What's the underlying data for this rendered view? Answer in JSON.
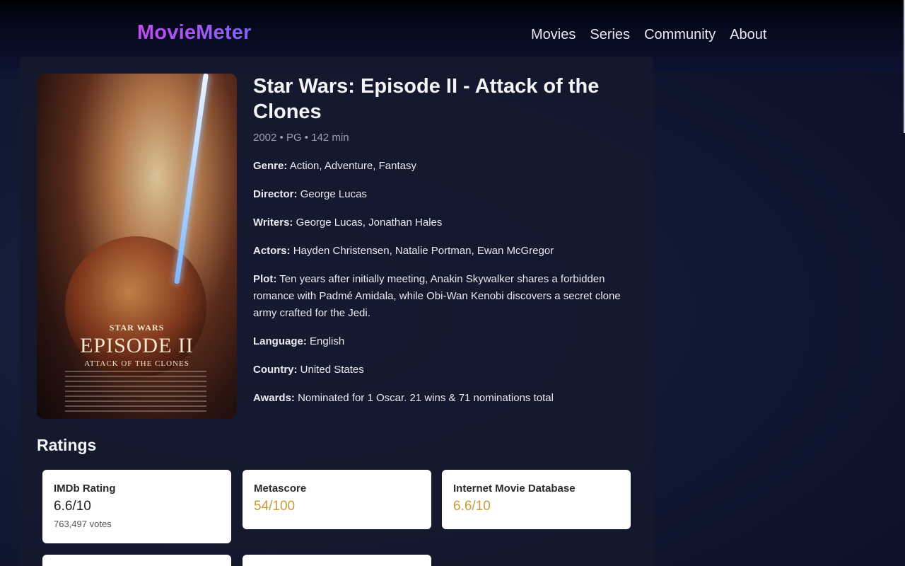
{
  "header": {
    "logo": "MovieMeter",
    "nav": [
      "Movies",
      "Series",
      "Community",
      "About"
    ]
  },
  "movie": {
    "title": "Star Wars: Episode II - Attack of the Clones",
    "meta": "2002 • PG • 142 min",
    "poster": {
      "line1": "STAR WARS",
      "line2": "EPISODE II",
      "line3": "ATTACK OF THE CLONES"
    },
    "fields": [
      {
        "label": "Genre:",
        "value": "Action, Adventure, Fantasy"
      },
      {
        "label": "Director:",
        "value": "George Lucas"
      },
      {
        "label": "Writers:",
        "value": "George Lucas, Jonathan Hales"
      },
      {
        "label": "Actors:",
        "value": "Hayden Christensen, Natalie Portman, Ewan McGregor"
      },
      {
        "label": "Plot:",
        "value": "Ten years after initially meeting, Anakin Skywalker shares a forbidden romance with Padmé Amidala, while Obi-Wan Kenobi discovers a secret clone army crafted for the Jedi."
      },
      {
        "label": "Language:",
        "value": "English"
      },
      {
        "label": "Country:",
        "value": "United States"
      },
      {
        "label": "Awards:",
        "value": "Nominated for 1 Oscar. 21 wins & 71 nominations total"
      }
    ]
  },
  "ratings": {
    "heading": "Ratings",
    "items": [
      {
        "source": "IMDb Rating",
        "value": "6.6/10",
        "votes": "763,497 votes"
      },
      {
        "source": "Metascore",
        "value": "54/100"
      },
      {
        "source": "Internet Movie Database",
        "value": "6.6/10"
      }
    ]
  },
  "colors": {
    "logo_gradient": [
      "#c04bf0",
      "#7d63f7"
    ],
    "rating_value_gold": "#c79a3a"
  }
}
